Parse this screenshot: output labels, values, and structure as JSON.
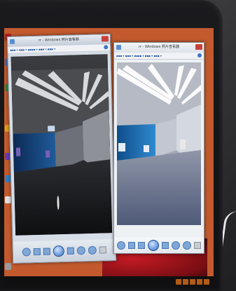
{
  "windows": {
    "left": {
      "title": "rr - Windows 照片查看器"
    },
    "right": {
      "title": "rr - Windows 照片查看器"
    }
  },
  "icons": {
    "close": "close-icon",
    "app": "photo-viewer-icon",
    "help": "help-icon",
    "zoom": "zoom-icon",
    "actual_size": "actual-size-icon",
    "previous": "previous-icon",
    "slideshow": "slideshow-icon",
    "next": "next-icon",
    "rotate_left": "rotate-left-icon",
    "rotate_right": "rotate-right-icon",
    "delete": "delete-icon"
  },
  "colors": {
    "desktop": "#c25a2e",
    "close_button": "#c9403a",
    "accent_blue": "#3f74c9"
  }
}
